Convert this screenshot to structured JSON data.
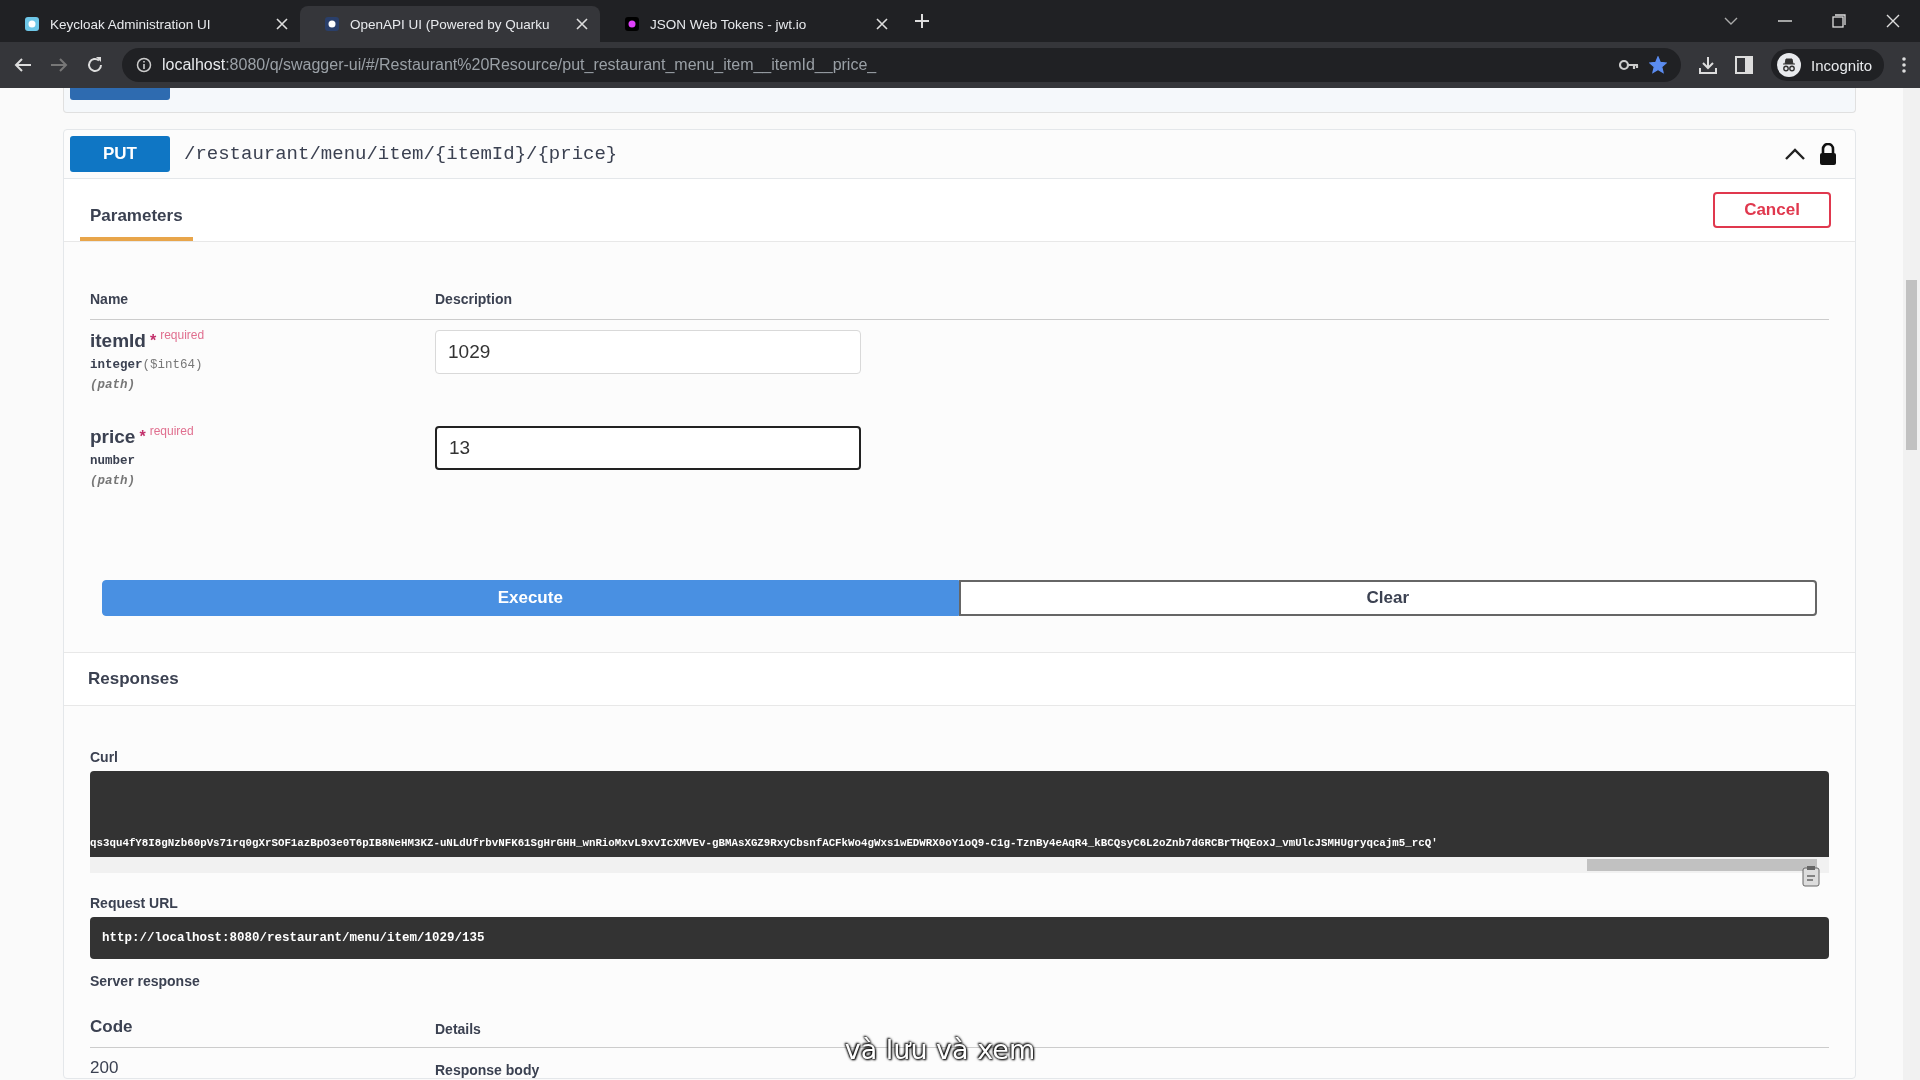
{
  "browser": {
    "tabs": [
      {
        "title": "Keycloak Administration UI",
        "selected": false
      },
      {
        "title": "OpenAPI UI (Powered by Quarku",
        "selected": true
      },
      {
        "title": "JSON Web Tokens - jwt.io",
        "selected": false
      }
    ],
    "url_host": "localhost",
    "url_rest": ":8080/q/swagger-ui/#/Restaurant%20Resource/put_restaurant_menu_item__itemId__price_",
    "profile": "Incognito",
    "bookmarked": true
  },
  "operation": {
    "method": "PUT",
    "path": "/restaurant/menu/item/{itemId}/{price}",
    "expanded": true,
    "tabs": [
      {
        "label": "Parameters",
        "selected": true
      }
    ],
    "cancel": "Cancel",
    "columns": [
      "Name",
      "Description"
    ],
    "parameters": [
      {
        "name": "itemId",
        "required_mark": "*",
        "required": "required",
        "type": "integer",
        "format": "($int64)",
        "location": "(path)",
        "value": "1029",
        "focused": false
      },
      {
        "name": "price",
        "required_mark": "*",
        "required": "required",
        "type": "number",
        "location": "(path)",
        "value": "13",
        "focused": true
      }
    ],
    "execute": "Execute",
    "clear": "Clear"
  },
  "responses": {
    "title": "Responses",
    "curl_label": "Curl",
    "curl": "qs3qu4fY8I8gNzb60pVs71rq0gXrSOF1azBpO3e0T6pIB8NeHM3KZ-uNLdUfrbvNFK61SgHrGHH_wnRioMxvL9xvIcXMVEv-gBMAsXGZ9RxyCbsnfACFkWo4gWxs1wEDWRX0oY1oQ9-C1g-TznBy4eAqR4_kBCQsyC6L2oZnb7dGRCBrTHQEoxJ_vmUlcJSMHUgryqcajm5_rcQ'",
    "request_url_label": "Request URL",
    "request_url": "http://localhost:8080/restaurant/menu/item/1029/135",
    "server_response_label": "Server response",
    "columns": [
      "Code",
      "Details"
    ],
    "code": "200",
    "details_heading": "Response body"
  },
  "subtitle": "và lưu và xem"
}
